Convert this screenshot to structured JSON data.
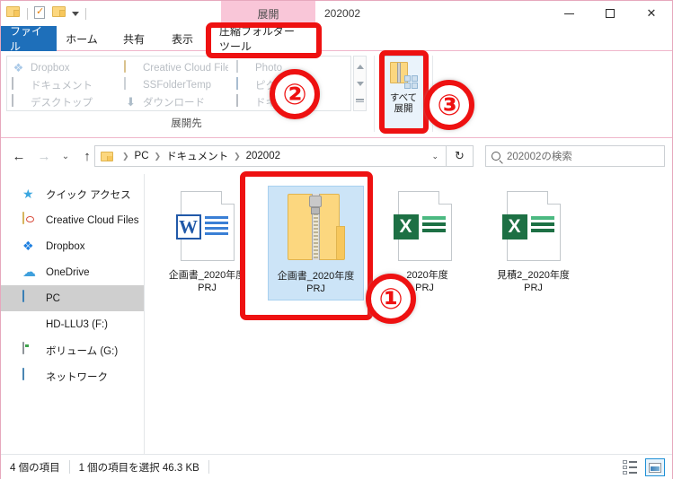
{
  "window": {
    "title": "202002",
    "contextual_header": "展開",
    "quick_access": [
      "folder-icon",
      "properties-icon",
      "new-folder-icon",
      "customize-caret-icon"
    ],
    "controls": {
      "minimize": "minimize-icon",
      "maximize": "maximize-icon",
      "close": "✕"
    }
  },
  "tabs": [
    {
      "label": "ファイル",
      "name": "tab-file",
      "active": false
    },
    {
      "label": "ホーム",
      "name": "tab-home",
      "active": false
    },
    {
      "label": "共有",
      "name": "tab-share",
      "active": false
    },
    {
      "label": "表示",
      "name": "tab-view",
      "active": false
    },
    {
      "label": "圧縮フォルダー ツール",
      "name": "tab-compressed-folder-tools",
      "active": true
    }
  ],
  "ribbon": {
    "collapse_icon": "chevron-up-icon",
    "help_icon": "help-icon",
    "group_label": "展開先",
    "gallery": {
      "col1": [
        "Dropbox",
        "ドキュメント",
        "デスクトップ"
      ],
      "col2": [
        "Creative Cloud Files",
        "SSFolderTemp",
        "ダウンロード"
      ],
      "col3": [
        "Photo",
        "ピクチャ",
        "ドキュ"
      ]
    },
    "extract_all_button": {
      "line1": "すべて",
      "line2": "展開"
    }
  },
  "address": {
    "back": "←",
    "forward": "→",
    "recent": "⌄",
    "up": "↑",
    "crumbs": [
      "PC",
      "ドキュメント",
      "202002"
    ],
    "dropdown_caret": "⌄",
    "refresh": "↻",
    "search_placeholder": "202002の検索"
  },
  "sidebar": {
    "items": [
      {
        "label": "クイック アクセス",
        "icon": "star-icon",
        "name": "sidebar-item-quick-access",
        "selected": false
      },
      {
        "label": "Creative Cloud Files",
        "icon": "creative-cloud-icon",
        "name": "sidebar-item-creative-cloud-files",
        "selected": false
      },
      {
        "label": "Dropbox",
        "icon": "dropbox-icon",
        "name": "sidebar-item-dropbox",
        "selected": false
      },
      {
        "label": "OneDrive",
        "icon": "onedrive-icon",
        "name": "sidebar-item-onedrive",
        "selected": false
      },
      {
        "label": "PC",
        "icon": "pc-icon",
        "name": "sidebar-item-pc",
        "selected": true
      },
      {
        "label": "HD-LLU3 (F:)",
        "icon": "harddisk-icon",
        "name": "sidebar-item-hd-llu3",
        "selected": false
      },
      {
        "label": "ボリューム (G:)",
        "icon": "volume-icon",
        "name": "sidebar-item-volume-g",
        "selected": false
      },
      {
        "label": "ネットワーク",
        "icon": "network-icon",
        "name": "sidebar-item-network",
        "selected": false
      }
    ]
  },
  "files": [
    {
      "name_line1": "企画書_2020年度",
      "name_line2": "PRJ",
      "type": "word",
      "selected": false
    },
    {
      "name_line1": "企画書_2020年度",
      "name_line2": "PRJ",
      "type": "zip",
      "selected": true
    },
    {
      "name_line1": "_2020年度",
      "name_line2": "PRJ",
      "type": "excel",
      "selected": false
    },
    {
      "name_line1": "見積2_2020年度",
      "name_line2": "PRJ",
      "type": "excel",
      "selected": false
    }
  ],
  "status": {
    "item_count": "4 個の項目",
    "selection": "1 個の項目を選択  46.3 KB",
    "view_details": "details-view-icon",
    "view_large_icons": "large-icons-view-icon"
  },
  "annotations": [
    {
      "number": "①",
      "target": "selected-zip-file"
    },
    {
      "number": "②",
      "target": "compressed-folder-tools-tab"
    },
    {
      "number": "③",
      "target": "extract-all-button"
    }
  ],
  "colors": {
    "accent_blue": "#1e6fba",
    "contextual_pink": "#f9c6d8",
    "annotation_red": "#ee1111",
    "selection_blue": "#cce4f7"
  }
}
